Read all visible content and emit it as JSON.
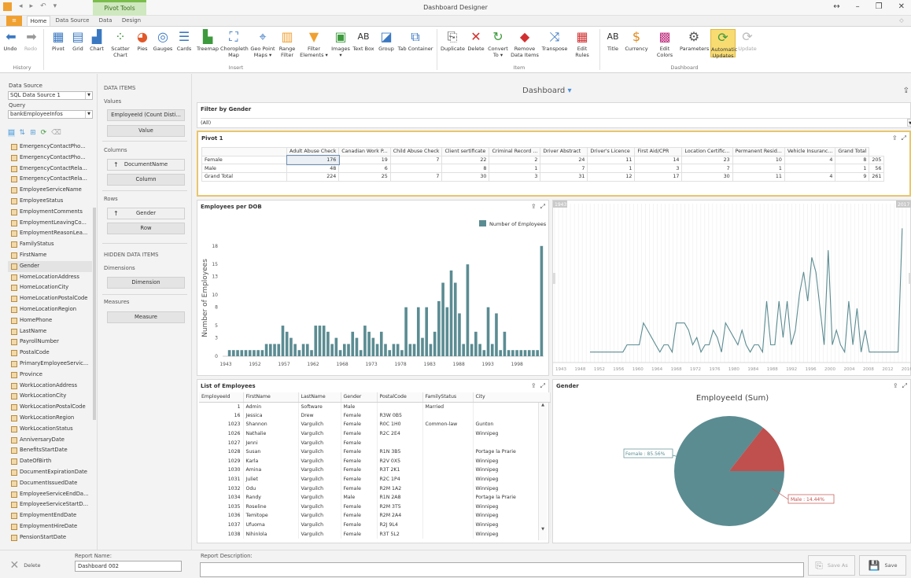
{
  "window": {
    "title": "Dashboard Designer",
    "context_tab": "Pivot Tools",
    "controls": [
      "↔",
      "–",
      "❐",
      "✕"
    ]
  },
  "tabs": [
    "Home",
    "Data Source",
    "Data",
    "Design"
  ],
  "ribbon": {
    "history": {
      "label": "History",
      "undo": "Undo",
      "redo": "Redo"
    },
    "insert": {
      "label": "Insert",
      "buttons": [
        "Pivot",
        "Grid",
        "Chart",
        "Scatter Chart",
        "Pies",
        "Gauges",
        "Cards",
        "Treemap",
        "Choropleth Map",
        "Geo Point Maps ▾",
        "Range Filter",
        "Filter Elements ▾",
        "Images ▾",
        "Text Box",
        "Group",
        "Tab Container"
      ]
    },
    "item": {
      "label": "Item",
      "buttons": [
        "Duplicate",
        "Delete",
        "Convert To ▾",
        "Remove Data Items",
        "Transpose",
        "Edit Rules"
      ]
    },
    "dashboard": {
      "label": "Dashboard",
      "buttons": [
        "Title",
        "Currency",
        "Edit Colors",
        "Parameters",
        "Automatic Updates",
        "Update"
      ]
    }
  },
  "fieldpanel": {
    "datasource_label": "Data Source",
    "datasource_value": "SQL Data Source 1",
    "query_label": "Query",
    "query_value": "bankEmployeeInfos",
    "fields": [
      "EmergencyContactPho...",
      "EmergencyContactPho...",
      "EmergencyContactRela...",
      "EmergencyContactRela...",
      "EmployeeServiceName",
      "EmployeeStatus",
      "EmploymentComments",
      "EmploymentLeavingCo...",
      "EmploymentReasonLea...",
      "FamilyStatus",
      "FirstName",
      "Gender",
      "HomeLocationAddress",
      "HomeLocationCity",
      "HomeLocationPostalCode",
      "HomeLocationRegion",
      "HomePhone",
      "LastName",
      "PayrollNumber",
      "PostalCode",
      "PrimaryEmployeeServic...",
      "Province",
      "WorkLocationAddress",
      "WorkLocationCity",
      "WorkLocationPostalCode",
      "WorkLocationRegion",
      "WorkLocationStatus",
      "AnniversaryDate",
      "BenefitsStartDate",
      "DateOfBirth",
      "DocumentExpirationDate",
      "DocumentIssuedDate",
      "EmployeeServiceEndDa...",
      "EmployeeServiceStartD...",
      "EmploymentEndDate",
      "EmploymentHireDate",
      "PensionStartDate"
    ],
    "selected_field": "Gender"
  },
  "dataitems": {
    "heading": "DATA ITEMS",
    "values_label": "Values",
    "values_item": "EmployeeId (Count Disti...",
    "value_slot": "Value",
    "columns_label": "Columns",
    "columns_item": "DocumentName",
    "column_slot": "Column",
    "rows_label": "Rows",
    "rows_item": "Gender",
    "row_slot": "Row",
    "hidden_heading": "HIDDEN DATA ITEMS",
    "dimensions_label": "Dimensions",
    "dimension_slot": "Dimension",
    "measures_label": "Measures",
    "measure_slot": "Measure"
  },
  "dashboard": {
    "title": "Dashboard"
  },
  "filter": {
    "title": "Filter by Gender",
    "value": "(All)"
  },
  "pivot": {
    "title": "Pivot 1",
    "columns": [
      "",
      "Adult Abuse Check",
      "Canadian Work P...",
      "Child Abuse Check",
      "Client sertificate",
      "Criminal Record ...",
      "Driver Abstract",
      "Driver's Licence",
      "First Aid/CPR",
      "Location Certific...",
      "Permanent Resid...",
      "Vehicle Insuranc...",
      "Grand Total"
    ],
    "rows": [
      [
        "Female",
        "176",
        "19",
        "7",
        "22",
        "2",
        "24",
        "11",
        "14",
        "23",
        "10",
        "4",
        "8",
        "205"
      ],
      [
        "Male",
        "48",
        "6",
        "",
        "8",
        "1",
        "7",
        "1",
        "3",
        "7",
        "1",
        "",
        "1",
        "56"
      ],
      [
        "Grand Total",
        "224",
        "25",
        "7",
        "30",
        "3",
        "31",
        "12",
        "17",
        "30",
        "11",
        "4",
        "9",
        "261"
      ]
    ]
  },
  "dob": {
    "title": "Employees per DOB"
  },
  "chart_data": [
    {
      "type": "bar",
      "title": "Employees per DOB",
      "ylabel": "Number of Employees",
      "xlabel": "",
      "legend": "Number of Employees",
      "legend_position": "top-right",
      "ylim": [
        0,
        19
      ],
      "yticks": [
        0,
        3,
        5,
        8,
        10,
        13,
        15,
        18
      ],
      "xticks": [
        "1943",
        "1952",
        "1957",
        "1962",
        "1968",
        "1973",
        "1978",
        "1983",
        "1988",
        "1993",
        "1998"
      ],
      "values": [
        1,
        1,
        1,
        1,
        1,
        1,
        1,
        1,
        1,
        2,
        2,
        2,
        2,
        5,
        4,
        3,
        2,
        1,
        2,
        2,
        1,
        5,
        5,
        5,
        4,
        2,
        3,
        1,
        2,
        2,
        4,
        3,
        1,
        5,
        4,
        3,
        2,
        4,
        2,
        1,
        2,
        2,
        1,
        8,
        2,
        2,
        8,
        3,
        8,
        2,
        4,
        9,
        12,
        8,
        14,
        12,
        7,
        2,
        15,
        2,
        4,
        2,
        1,
        8,
        2,
        7,
        1,
        4,
        1,
        1,
        1,
        1,
        1,
        1,
        1,
        1,
        18
      ]
    },
    {
      "type": "line",
      "title": "",
      "range_start": "1943",
      "range_end": "2017",
      "xticks": [
        "1943",
        "1948",
        "1952",
        "1956",
        "1960",
        "1964",
        "1968",
        "1972",
        "1976",
        "1980",
        "1984",
        "1988",
        "1992",
        "1996",
        "2000",
        "2004",
        "2008",
        "2012",
        "2016"
      ],
      "values": [
        1,
        1,
        1,
        1,
        1,
        1,
        1,
        1,
        1,
        2,
        2,
        2,
        2,
        5,
        4,
        3,
        2,
        1,
        2,
        2,
        1,
        5,
        5,
        5,
        4,
        2,
        3,
        1,
        2,
        2,
        4,
        3,
        1,
        5,
        4,
        3,
        2,
        4,
        2,
        1,
        2,
        2,
        1,
        8,
        2,
        2,
        8,
        3,
        8,
        2,
        4,
        9,
        12,
        8,
        14,
        12,
        7,
        2,
        15,
        2,
        4,
        2,
        1,
        8,
        2,
        7,
        1,
        4,
        1,
        1,
        1,
        1,
        1,
        1,
        1,
        1,
        18
      ]
    },
    {
      "type": "pie",
      "title": "EmployeeId (Sum)",
      "slices": [
        {
          "label": "Female",
          "value": 85.56,
          "display": "Female : 85.56%",
          "color": "#5b8c92"
        },
        {
          "label": "Male",
          "value": 14.44,
          "display": "Male : 14.44%",
          "color": "#c0504d"
        }
      ]
    }
  ],
  "employees": {
    "title": "List of Employees",
    "columns": [
      "EmployeeId",
      "FirstName",
      "LastName",
      "Gender",
      "PostalCode",
      "FamilyStatus",
      "City"
    ],
    "rows": [
      [
        "1",
        "Admin",
        "Software",
        "Male",
        "",
        "Married",
        ""
      ],
      [
        "16",
        "Jessica",
        "Drew",
        "Female",
        "R3W 0B5",
        "",
        ""
      ],
      [
        "1023",
        "Shannon",
        "Varguilch",
        "Female",
        "R0C 1H0",
        "Common-law",
        "Gunton"
      ],
      [
        "1026",
        "Nathalie",
        "Varguilch",
        "Female",
        "R2C 2E4",
        "",
        "Winnipeg"
      ],
      [
        "1027",
        "Jenni",
        "Varguilch",
        "Female",
        "",
        "",
        ""
      ],
      [
        "1028",
        "Susan",
        "Varguilch",
        "Female",
        "R1N 3B5",
        "",
        "Portage la Prarie"
      ],
      [
        "1029",
        "Karla",
        "Varguilch",
        "Female",
        "R2V 0X5",
        "",
        "Winnipeg"
      ],
      [
        "1030",
        "Amina",
        "Varguilch",
        "Female",
        "R3T 2K1",
        "",
        "Winnipeg"
      ],
      [
        "1031",
        "Juliet",
        "Varguilch",
        "Female",
        "R2C 1P4",
        "",
        "Winnipeg"
      ],
      [
        "1032",
        "Odu",
        "Varguilch",
        "Female",
        "R2M 1A2",
        "",
        "Winnipeg"
      ],
      [
        "1034",
        "Randy",
        "Varguilch",
        "Male",
        "R1N 2A8",
        "",
        "Portage la Prarie"
      ],
      [
        "1035",
        "Roseline",
        "Varguilch",
        "Female",
        "R2M 3T5",
        "",
        "Winnipeg"
      ],
      [
        "1036",
        "Temitope",
        "Varguilch",
        "Female",
        "R2M 2A4",
        "",
        "Winnipeg"
      ],
      [
        "1037",
        "Ufuoma",
        "Varguilch",
        "Female",
        "R2J 9L4",
        "",
        "Winnipeg"
      ],
      [
        "1038",
        "Nihinlola",
        "Varguilch",
        "Female",
        "R3T 5L2",
        "",
        "Winnipeg"
      ]
    ]
  },
  "gender": {
    "title": "Gender"
  },
  "bottom": {
    "delete": "Delete",
    "report_name_label": "Report Name:",
    "report_name": "Dashboard 002",
    "description_label": "Report Description:",
    "save_as": "Save As",
    "save": "Save"
  },
  "colors": {
    "bar": "#5b8c92",
    "accent": "#e8c66c",
    "pie_female": "#5b8c92",
    "pie_male": "#c0504d"
  }
}
